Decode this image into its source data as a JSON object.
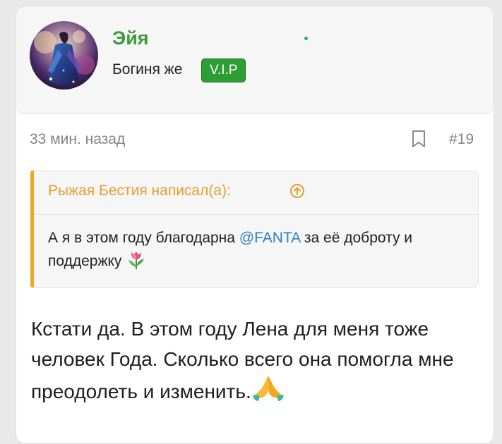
{
  "author": {
    "name": "Эйя",
    "rank": "Богиня же",
    "badge": "V.I.P"
  },
  "post": {
    "time": "33 мин. назад",
    "number": "#19",
    "bookmark_icon": "bookmark-icon"
  },
  "quote": {
    "author": "Рыжая Бестия написал(а):",
    "text_before": "А я в этом году благодарна ",
    "mention": "@FANTA",
    "text_after": " за её доброту и поддержку",
    "emoji": "tulip-icon"
  },
  "message": {
    "text": "Кстати да. В этом году Лена для меня тоже человек Года. Сколько всего она помогла мне преодолеть и изменить.",
    "emoji": "folded-hands-icon"
  },
  "colors": {
    "name": "#3f9a3c",
    "vip_badge": "#2c9e33",
    "quote_accent": "#f0a523",
    "mention": "#2b7fc3"
  }
}
